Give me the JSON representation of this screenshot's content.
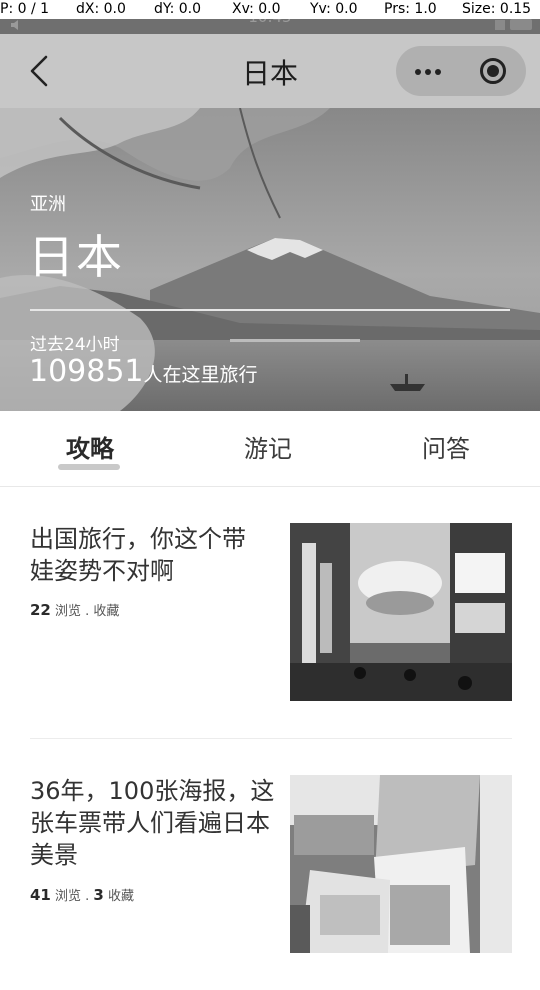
{
  "debug": {
    "pointer": "P: 0 / 1",
    "dx": "dX: 0.0",
    "dy": "dY: 0.0",
    "xv": "Xv: 0.0",
    "yv": "Yv: 0.0",
    "prs": "Prs: 1.0",
    "size": "Size: 0.15"
  },
  "status_bar": {
    "time": "10:45"
  },
  "nav": {
    "title": "日本",
    "back_icon": "chevron-left-icon",
    "more_icon": "more-dots-icon",
    "close_icon": "target-close-icon"
  },
  "hero": {
    "region": "亚洲",
    "country": "日本",
    "period_label": "过去24小时",
    "traveler_count": "109851",
    "traveler_suffix": "人在这里旅行"
  },
  "tabs": [
    {
      "label": "攻略",
      "active": true
    },
    {
      "label": "游记",
      "active": false
    },
    {
      "label": "问答",
      "active": false
    }
  ],
  "articles": [
    {
      "title": "出国旅行，你这个带娃姿势不对啊",
      "views": "22",
      "views_label": "浏览 .",
      "favorites": "",
      "favorites_label": "收藏"
    },
    {
      "title": "36年，100张海报，这张车票带人们看遍日本美景",
      "views": "41",
      "views_label": "浏览 .",
      "favorites": "3",
      "favorites_label": "收藏"
    }
  ],
  "colors": {
    "nav_background": "#c7c7c7",
    "status_bar": "#6f6f6f",
    "tab_indicator": "#c9c9c9"
  }
}
